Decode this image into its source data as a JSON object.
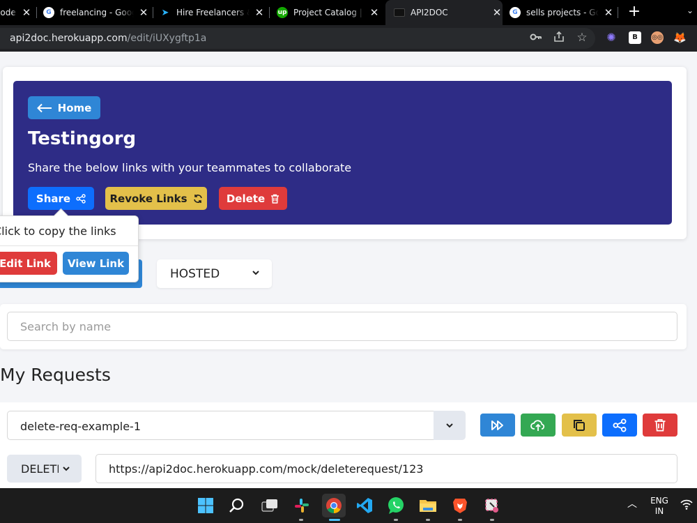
{
  "browser": {
    "tabs": [
      {
        "title": "Code",
        "favicon": "codepen-icon",
        "active": false
      },
      {
        "title": "freelancing - Google Search",
        "favicon": "google-icon",
        "active": false
      },
      {
        "title": "Hire Freelancers & Find Freelance Jobs",
        "favicon": "freelancer-icon",
        "active": false
      },
      {
        "title": "Project Catalog | Upwork",
        "favicon": "upwork-icon",
        "active": false
      },
      {
        "title": "API2DOC",
        "favicon": "api2doc-icon",
        "active": true
      },
      {
        "title": "sells projects - Google Search",
        "favicon": "google-icon",
        "active": false
      }
    ],
    "new_tab": "+",
    "address": {
      "host": "api2doc.herokuapp.com",
      "path": "/edit/iUXygftp1a"
    },
    "toolbar_icons": [
      "key-icon",
      "share-icon",
      "star-icon"
    ],
    "extensions": [
      "snowflake-extension-icon",
      "b-extension-icon",
      "glasses-extension-icon",
      "metamask-extension-icon"
    ]
  },
  "hero": {
    "home_label": "Home",
    "title": "Testingorg",
    "subtitle": "Share the below links with your teammates to collaborate",
    "share_label": "Share",
    "revoke_label": "Revoke Links",
    "delete_label": "Delete",
    "background": "#2e2c86"
  },
  "popover": {
    "text": "Click to copy the links",
    "edit_label": "Edit Link",
    "view_label": "View Link"
  },
  "hosting": {
    "selected": "HOSTED"
  },
  "search": {
    "placeholder": "Search by name",
    "value": ""
  },
  "requests": {
    "title": "My Requests",
    "selected": "delete-req-example-1",
    "method": "DELETE",
    "url": "https://api2doc.herokuapp.com/mock/deleterequest/123",
    "actions": [
      {
        "icon": "run-all-icon",
        "color": "#2f86d6"
      },
      {
        "icon": "upload-cloud-icon",
        "color": "#34a853"
      },
      {
        "icon": "copy-icon",
        "color": "#e3c04a"
      },
      {
        "icon": "share-icon",
        "color": "#0d6efd"
      },
      {
        "icon": "trash-icon",
        "color": "#df3b3b"
      }
    ]
  },
  "taskbar": {
    "apps": [
      "windows-start-icon",
      "search-icon",
      "task-view-icon",
      "slack-icon",
      "chrome-icon",
      "vscode-icon",
      "whatsapp-icon",
      "file-explorer-icon",
      "brave-icon",
      "snipping-tool-icon"
    ],
    "language_line1": "ENG",
    "language_line2": "IN"
  }
}
